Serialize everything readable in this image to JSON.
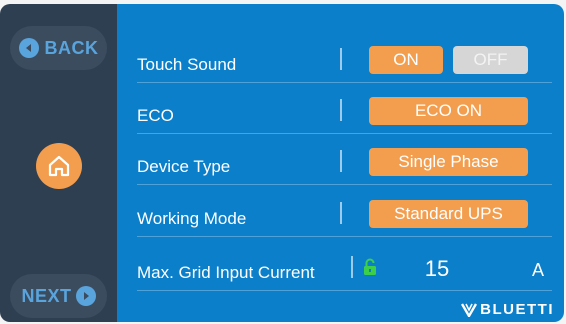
{
  "sidebar": {
    "back_label": "BACK",
    "next_label": "NEXT",
    "back_icon": "chevron-left-circle-icon",
    "next_icon": "chevron-right-circle-icon",
    "home_icon": "home-icon"
  },
  "settings": {
    "touch_sound": {
      "label": "Touch Sound",
      "on_label": "ON",
      "off_label": "OFF",
      "selected": "ON"
    },
    "eco": {
      "label": "ECO",
      "value": "ECO ON"
    },
    "device_type": {
      "label": "Device Type",
      "value": "Single Phase"
    },
    "working_mode": {
      "label": "Working Mode",
      "value": "Standard UPS"
    },
    "grid_input": {
      "label": "Max. Grid Input Current",
      "value": "15",
      "unit": "A",
      "lock_icon": "unlocked-lock-icon"
    }
  },
  "brand": {
    "logo_text": "BLUETTI"
  },
  "colors": {
    "accent_orange": "#f39e4e",
    "main_blue": "#0b7fca",
    "sidebar_dark": "#2e3f52",
    "button_blue_text": "#5aa4dd",
    "lock_green": "#3ecf4a",
    "off_gray": "#d6d6d6"
  }
}
